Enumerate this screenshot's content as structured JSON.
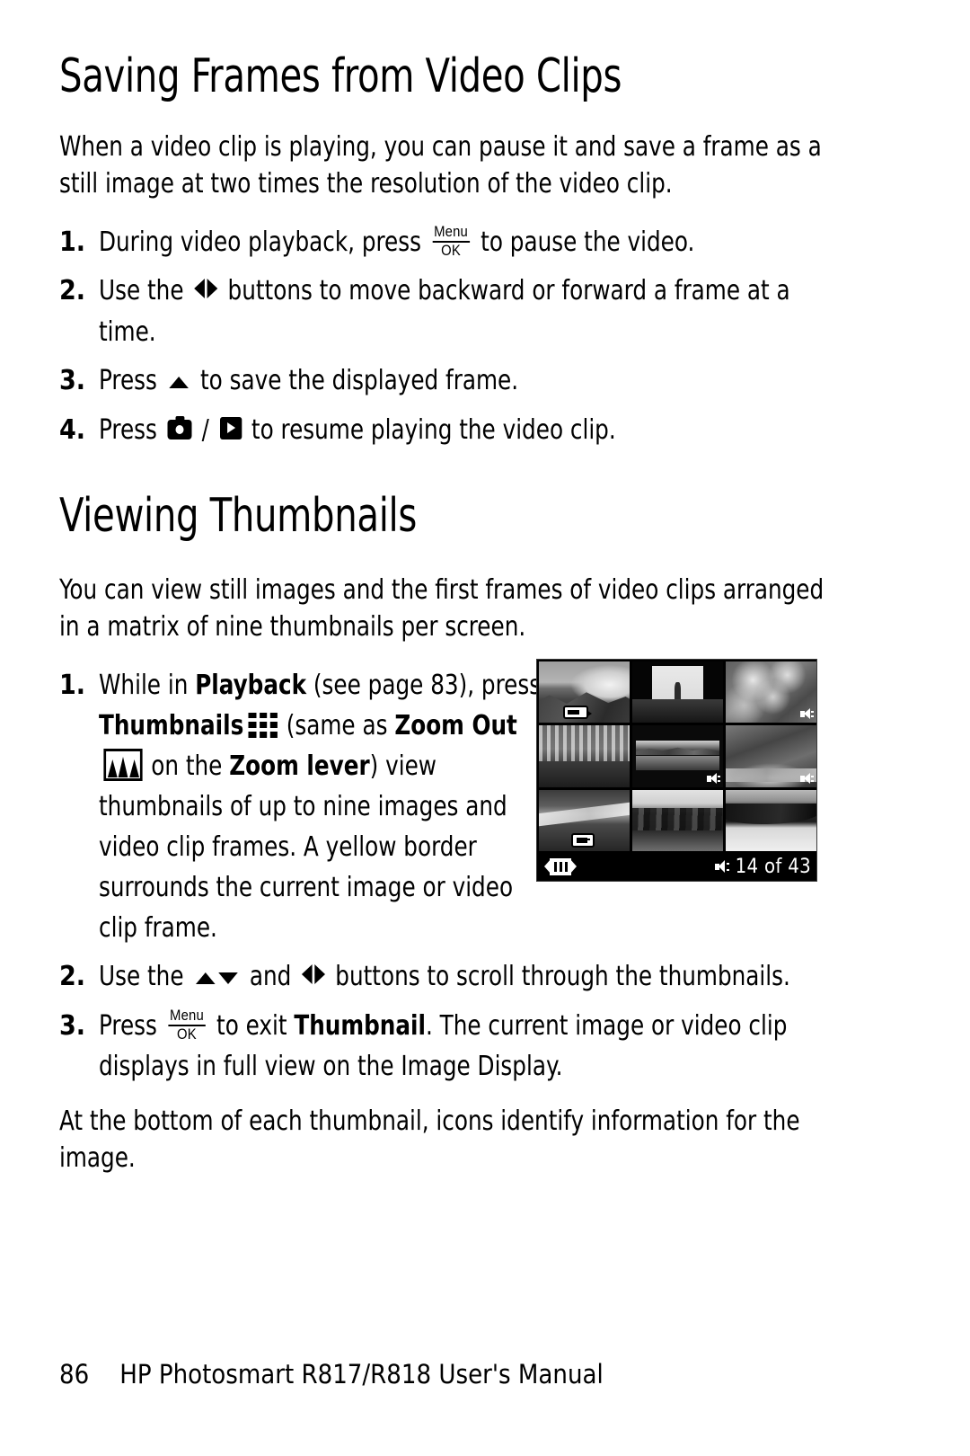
{
  "page": {
    "number": "86",
    "footer_title": "HP Photosmart R817/R818 User's Manual"
  },
  "sections": [
    {
      "heading": "Saving Frames from Video Clips",
      "intro": "When a video clip is playing, you can pause it and save a frame as a still image at two times the resolution of the video clip.",
      "steps": [
        {
          "number": "1.",
          "parts": [
            {
              "t": "text",
              "v": "During video playback, press "
            },
            {
              "t": "icon",
              "v": "menu-ok-icon"
            },
            {
              "t": "text",
              "v": " to pause the video."
            }
          ]
        },
        {
          "number": "2.",
          "parts": [
            {
              "t": "text",
              "v": "Use the "
            },
            {
              "t": "icon",
              "v": "left-right-arrows-icon"
            },
            {
              "t": "text",
              "v": " buttons to move backward or forward a frame at a time."
            }
          ]
        },
        {
          "number": "3.",
          "parts": [
            {
              "t": "text",
              "v": "Press "
            },
            {
              "t": "icon",
              "v": "up-arrow-icon"
            },
            {
              "t": "text",
              "v": " to save the displayed frame."
            }
          ]
        },
        {
          "number": "4.",
          "parts": [
            {
              "t": "text",
              "v": "Press "
            },
            {
              "t": "icon",
              "v": "camera-icon"
            },
            {
              "t": "text",
              "v": " / "
            },
            {
              "t": "icon",
              "v": "play-icon"
            },
            {
              "t": "text",
              "v": " to resume playing the video clip."
            }
          ]
        }
      ]
    },
    {
      "heading": "Viewing Thumbnails",
      "intro": "You can view still images and the first frames of video clips arranged in a matrix of nine thumbnails per screen.",
      "steps": [
        {
          "number": "1.",
          "text_runs": {
            "a": "While in ",
            "b1": "Playback",
            "b": " (see page 83), press ",
            "b2": "Thumbnails",
            "c": " (same as ",
            "b3": "Zoom Out",
            "d": " on the ",
            "b4": "Zoom lever",
            "e": ") view thumbnails of up to nine images and video clip frames. A yellow border surrounds the current image or video clip frame."
          }
        },
        {
          "number": "2.",
          "text_runs": {
            "a": "Use the ",
            "b": " and ",
            "c": " buttons to scroll through the thumbnails."
          }
        },
        {
          "number": "3.",
          "text_runs": {
            "a": "Press ",
            "b": " to exit ",
            "b1": "Thumbnail",
            "c": ". The current image or video clip displays in full view on the Image Display."
          }
        }
      ],
      "closing": "At the bottom of each thumbnail, icons identify information for the image."
    }
  ],
  "figure": {
    "name": "thumbnail-screen",
    "status_count": "14 of 43",
    "status_left_icon": "filmstrip-icon",
    "status_right_icon": "speaker-icon",
    "selected_index": 4,
    "cells": [
      {
        "scene": "mountain-lake",
        "badge": "print-icon"
      },
      {
        "scene": "statue",
        "badge": "none"
      },
      {
        "scene": "foliage",
        "badge": "speaker-icon"
      },
      {
        "scene": "building",
        "badge": "none"
      },
      {
        "scene": "lake-panorama",
        "badge": "speaker-icon"
      },
      {
        "scene": "waterfall",
        "badge": "speaker-icon"
      },
      {
        "scene": "shoreline",
        "badge": "rotate-icon"
      },
      {
        "scene": "palm-trees",
        "badge": "none"
      },
      {
        "scene": "beach-cove",
        "badge": "none"
      }
    ]
  },
  "icons": {
    "menu_label": "Menu",
    "ok_label": "OK"
  }
}
